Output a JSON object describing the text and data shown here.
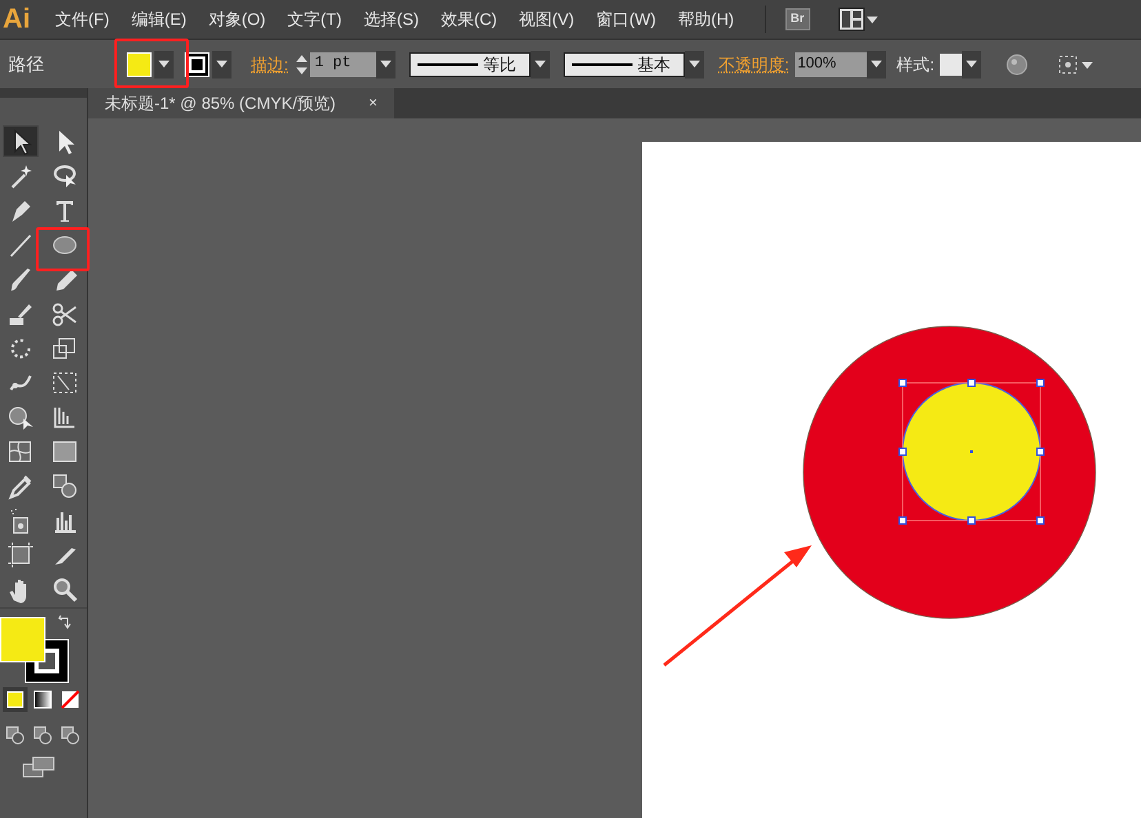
{
  "app": {
    "logo": "Ai"
  },
  "menu": [
    "文件(F)",
    "编辑(E)",
    "对象(O)",
    "文字(T)",
    "选择(S)",
    "效果(C)",
    "视图(V)",
    "窗口(W)",
    "帮助(H)"
  ],
  "menu_icons": {
    "bridge": "Br"
  },
  "control_bar": {
    "object_type": "路径",
    "stroke_label": "描边:",
    "stroke_weight": "1 pt",
    "profile": "等比",
    "brush": "基本",
    "opacity_label": "不透明度:",
    "opacity": "100%",
    "style_label": "样式:"
  },
  "document_tab": {
    "title": "未标题-1* @ 85% (CMYK/预览)",
    "close": "×"
  },
  "tools": [
    {
      "kind": "selection",
      "selected": true
    },
    {
      "kind": "direct",
      "selected": false
    },
    {
      "kind": "wand",
      "selected": false
    },
    {
      "kind": "lasso",
      "selected": false
    },
    {
      "kind": "pen",
      "selected": false
    },
    {
      "kind": "type",
      "selected": false
    },
    {
      "kind": "line",
      "selected": false
    },
    {
      "kind": "ellipse",
      "selected": false
    },
    {
      "kind": "brush",
      "selected": false
    },
    {
      "kind": "pencil",
      "selected": false
    },
    {
      "kind": "eraser",
      "selected": false
    },
    {
      "kind": "scissors",
      "selected": false
    },
    {
      "kind": "rotate",
      "selected": false
    },
    {
      "kind": "scale",
      "selected": false
    },
    {
      "kind": "warp",
      "selected": false
    },
    {
      "kind": "freetransform",
      "selected": false
    },
    {
      "kind": "shapebuilder",
      "selected": false
    },
    {
      "kind": "grid",
      "selected": false
    },
    {
      "kind": "mesh",
      "selected": false
    },
    {
      "kind": "gradient",
      "selected": false
    },
    {
      "kind": "eyedropper",
      "selected": false
    },
    {
      "kind": "blend",
      "selected": false
    },
    {
      "kind": "spray",
      "selected": false
    },
    {
      "kind": "graph",
      "selected": false
    },
    {
      "kind": "artboard",
      "selected": false
    },
    {
      "kind": "slice",
      "selected": false
    },
    {
      "kind": "hand",
      "selected": false
    },
    {
      "kind": "zoom",
      "selected": false
    }
  ]
}
